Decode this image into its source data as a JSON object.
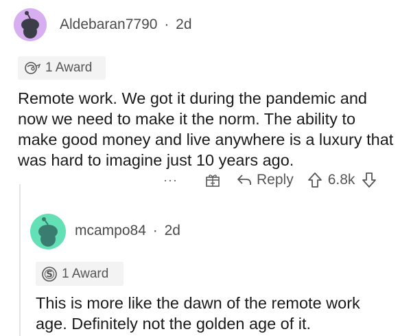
{
  "comment1": {
    "username": "Aldebaran7790",
    "separator": "·",
    "age": "2d",
    "award_label": "1 Award",
    "body": "Remote work. We got it during the pandemic and now we need to make it the norm. The ability to make good money and live anywhere is a luxury that was hard to imagine just 10 years ago.",
    "actions": {
      "more_label": "···",
      "reply_label": "Reply",
      "score": "6.8k"
    },
    "avatar_color": "#cfa3ec"
  },
  "comment2": {
    "username": "mcampo84",
    "separator": "·",
    "age": "2d",
    "award_label": "1 Award",
    "body": "This is more like the dawn of the remote work age. Definitely not the golden age of it.",
    "avatar_color": "#63e0b6"
  }
}
